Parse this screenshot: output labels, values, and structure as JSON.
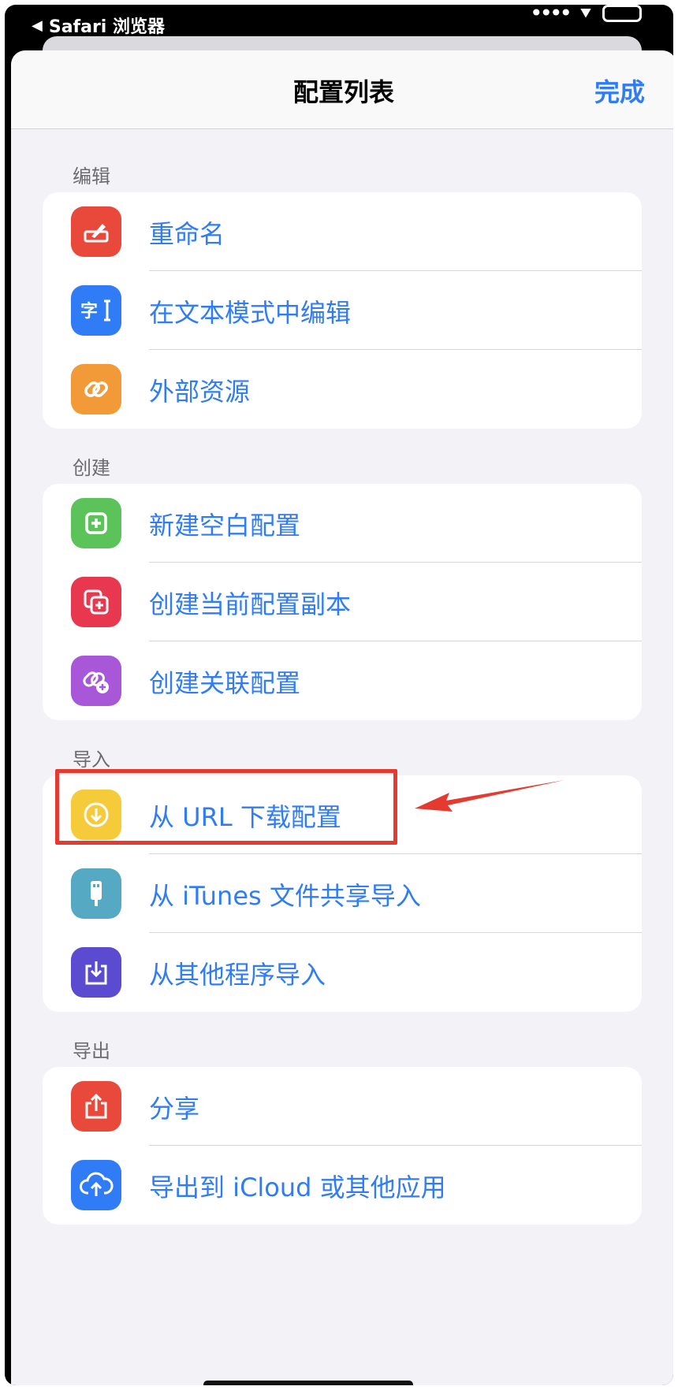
{
  "status_bar": {
    "back_app_label": "Safari 浏览器"
  },
  "nav": {
    "title": "配置列表",
    "done_label": "完成"
  },
  "sections": [
    {
      "header": "编辑",
      "items": [
        {
          "label": "重命名",
          "icon": "rename-icon",
          "color": "#e8493a"
        },
        {
          "label": "在文本模式中编辑",
          "icon": "text-edit-icon",
          "color": "#2f7cf6"
        },
        {
          "label": "外部资源",
          "icon": "link-icon",
          "color": "#f19a37"
        }
      ]
    },
    {
      "header": "创建",
      "items": [
        {
          "label": "新建空白配置",
          "icon": "plus-square-icon",
          "color": "#5cc35b"
        },
        {
          "label": "创建当前配置副本",
          "icon": "duplicate-icon",
          "color": "#e8384f"
        },
        {
          "label": "创建关联配置",
          "icon": "link-add-icon",
          "color": "#a957d9"
        }
      ]
    },
    {
      "header": "导入",
      "items": [
        {
          "label": "从 URL 下载配置",
          "icon": "download-circle-icon",
          "color": "#f5cb3a"
        },
        {
          "label": "从 iTunes 文件共享导入",
          "icon": "usb-icon",
          "color": "#56a9c2"
        },
        {
          "label": "从其他程序导入",
          "icon": "import-tray-icon",
          "color": "#5a4bd1"
        }
      ]
    },
    {
      "header": "导出",
      "items": [
        {
          "label": "分享",
          "icon": "share-icon",
          "color": "#e8493a"
        },
        {
          "label": "导出到 iCloud 或其他应用",
          "icon": "cloud-upload-icon",
          "color": "#2f7cf6"
        }
      ]
    }
  ],
  "annotation_color": "#e53a2f",
  "accent": "#2f7cf6"
}
